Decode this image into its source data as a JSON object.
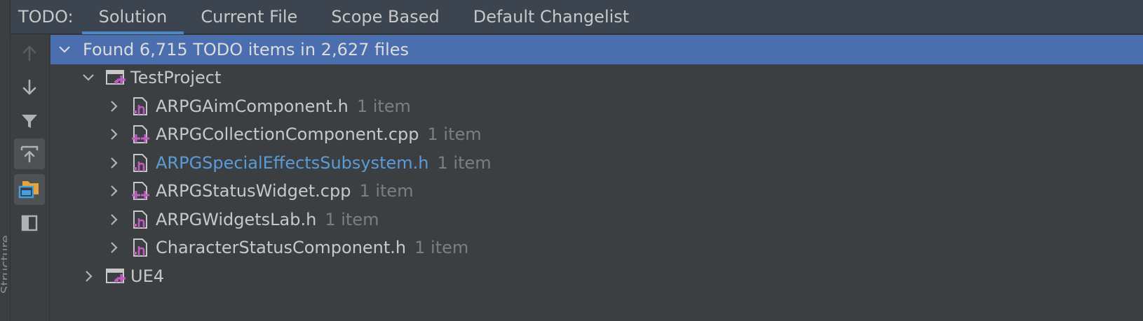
{
  "side_strip": {
    "label": "Structure"
  },
  "header": {
    "tool_title": "TODO:",
    "tabs": [
      {
        "label": "Solution",
        "active": true
      },
      {
        "label": "Current File",
        "active": false
      },
      {
        "label": "Scope Based",
        "active": false
      },
      {
        "label": "Default Changelist",
        "active": false
      }
    ]
  },
  "toolbar": {
    "buttons": [
      {
        "icon": "arrow-up-icon",
        "toggled": false,
        "enabled": false
      },
      {
        "icon": "arrow-down-icon",
        "toggled": false,
        "enabled": true
      },
      {
        "icon": "filter-icon",
        "toggled": false,
        "enabled": true
      },
      {
        "icon": "autoscroll-to-source-icon",
        "toggled": true,
        "enabled": true
      },
      {
        "icon": "preview-folder-icon",
        "toggled": true,
        "enabled": true
      },
      {
        "icon": "preview-panel-icon",
        "toggled": false,
        "enabled": true
      }
    ]
  },
  "tree": {
    "summary": "Found 6,715 TODO items in 2,627 files",
    "project": {
      "name": "TestProject",
      "expanded": true
    },
    "files": [
      {
        "name": "ARPGAimComponent.h",
        "count": "1 item",
        "type": "h",
        "modified": false
      },
      {
        "name": "ARPGCollectionComponent.cpp",
        "count": "1 item",
        "type": "cpp",
        "modified": false
      },
      {
        "name": "ARPGSpecialEffectsSubsystem.h",
        "count": "1 item",
        "type": "h",
        "modified": true
      },
      {
        "name": "ARPGStatusWidget.cpp",
        "count": "1 item",
        "type": "cpp",
        "modified": false
      },
      {
        "name": "ARPGWidgetsLab.h",
        "count": "1 item",
        "type": "h",
        "modified": false
      },
      {
        "name": "CharacterStatusComponent.h",
        "count": "1 item",
        "type": "h",
        "modified": false
      }
    ],
    "second_project": {
      "name": "UE4",
      "expanded": false
    }
  },
  "colors": {
    "selection": "#4b6eaf",
    "tab_underline": "#4a88c7",
    "modified_file": "#5a9bd8",
    "file_icon_accent": "#c05bbf"
  }
}
